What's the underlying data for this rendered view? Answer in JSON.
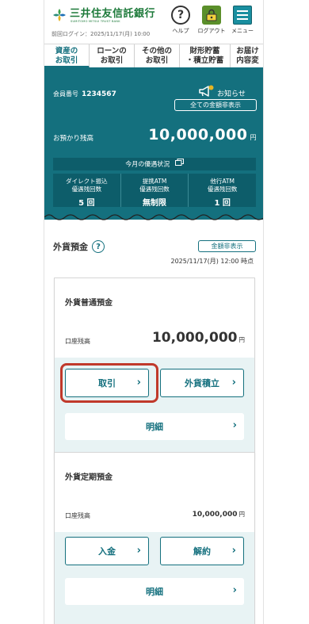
{
  "header": {
    "bank_name": "三井住友信託銀行",
    "bank_name_en": "SUMITOMO MITSUI TRUST BANK",
    "last_login": "前回ログイン：2025/11/17(月) 10:00",
    "help_label": "ヘルプ",
    "logout_label": "ログアウト",
    "menu_label": "メニュー",
    "brand_color": "#1d7a3a",
    "accent_color": "#14707e"
  },
  "tabs": [
    {
      "label": "資産の\nお取引",
      "active": true
    },
    {
      "label": "ローンの\nお取引",
      "active": false
    },
    {
      "label": "その他の\nお取引",
      "active": false
    },
    {
      "label": "財形貯蓄\n・積立貯蓄",
      "active": false
    },
    {
      "label": "お届け\n内容変",
      "active": false
    }
  ],
  "summary": {
    "member_label": "会員番号",
    "member_number": "1234567",
    "notice_label": "お知らせ",
    "hide_all_label": "全ての金額非表示",
    "balance_label": "お預かり残高",
    "balance_value": "10,000,000",
    "balance_unit": "円",
    "benefit_title": "今月の優遇状況",
    "benefits": [
      {
        "label": "ダイレクト振込\n優遇残回数",
        "value": "5 回"
      },
      {
        "label": "提携ATM\n優遇残回数",
        "value": "無制限"
      },
      {
        "label": "他行ATM\n優遇残回数",
        "value": "1 回"
      }
    ]
  },
  "section": {
    "title": "外貨預金",
    "help_icon": "?",
    "hide_label": "金額非表示",
    "as_of": "2025/11/17(月) 12:00 時点"
  },
  "cards": [
    {
      "title": "外貨普通預金",
      "balance_label": "口座残高",
      "balance_value": "10,000,000",
      "unit": "円",
      "btn1": "取引",
      "btn2": "外貨積立",
      "detail": "明細"
    },
    {
      "title": "外貨定期預金",
      "balance_label": "口座残高",
      "balance_value": "10,000,000",
      "unit": "円",
      "btn1": "入金",
      "btn2": "解約",
      "detail": "明細"
    }
  ]
}
